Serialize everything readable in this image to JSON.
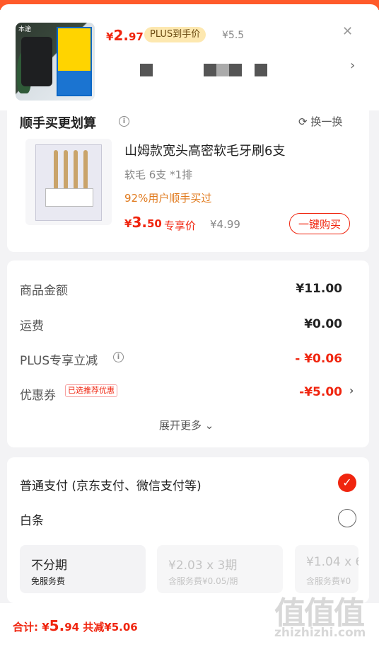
{
  "header": {
    "price_yen": "¥",
    "price_int": "2.",
    "price_dec": "97",
    "plus_badge": "PLUS到手价",
    "orig_price": "¥5.5",
    "thumb_brand": "本途"
  },
  "recommend": {
    "title": "顺手买更划算",
    "swap_label": "换一换",
    "product": {
      "name": "山姆款宽头高密软毛牙刷6支",
      "spec": "软毛 6支 *1排",
      "buyer_pct": "92%用户顺手买过",
      "price_yen": "¥",
      "price_int": "3.",
      "price_dec": "50",
      "price_tag": "专享价",
      "orig_price": "¥4.99",
      "buy_button": "一键购买"
    }
  },
  "summary": {
    "rows": [
      {
        "label": "商品金额",
        "value": "¥11.00"
      },
      {
        "label": "运费",
        "value": "¥0.00"
      },
      {
        "label": "PLUS专享立减",
        "value": "- ¥0.06"
      },
      {
        "label": "优惠券",
        "value": "-¥5.00"
      }
    ],
    "coupon_tag": "已选推荐优惠",
    "expand_label": "展开更多"
  },
  "payment": {
    "option1": "普通支付 (京东支付、微信支付等)",
    "option2": "白条",
    "installments": [
      {
        "title": "不分期",
        "sub": "免服务费"
      },
      {
        "title": "¥2.03 x 3期",
        "sub": "含服务费¥0.05/期"
      },
      {
        "title": "¥1.04 x 6",
        "sub": "含服务费¥0"
      }
    ]
  },
  "footer": {
    "total_label": "合计: ",
    "total_yen": "¥",
    "total_int": "5.",
    "total_dec": "94",
    "discount": " 共减¥5.06"
  },
  "watermark": {
    "logo": "值值值",
    "url": "zhizhizhi.com"
  },
  "colors": {
    "accent": "#f0250f",
    "plus_badge_bg": "#fde8b0",
    "buyer_pct": "#e0791c"
  }
}
